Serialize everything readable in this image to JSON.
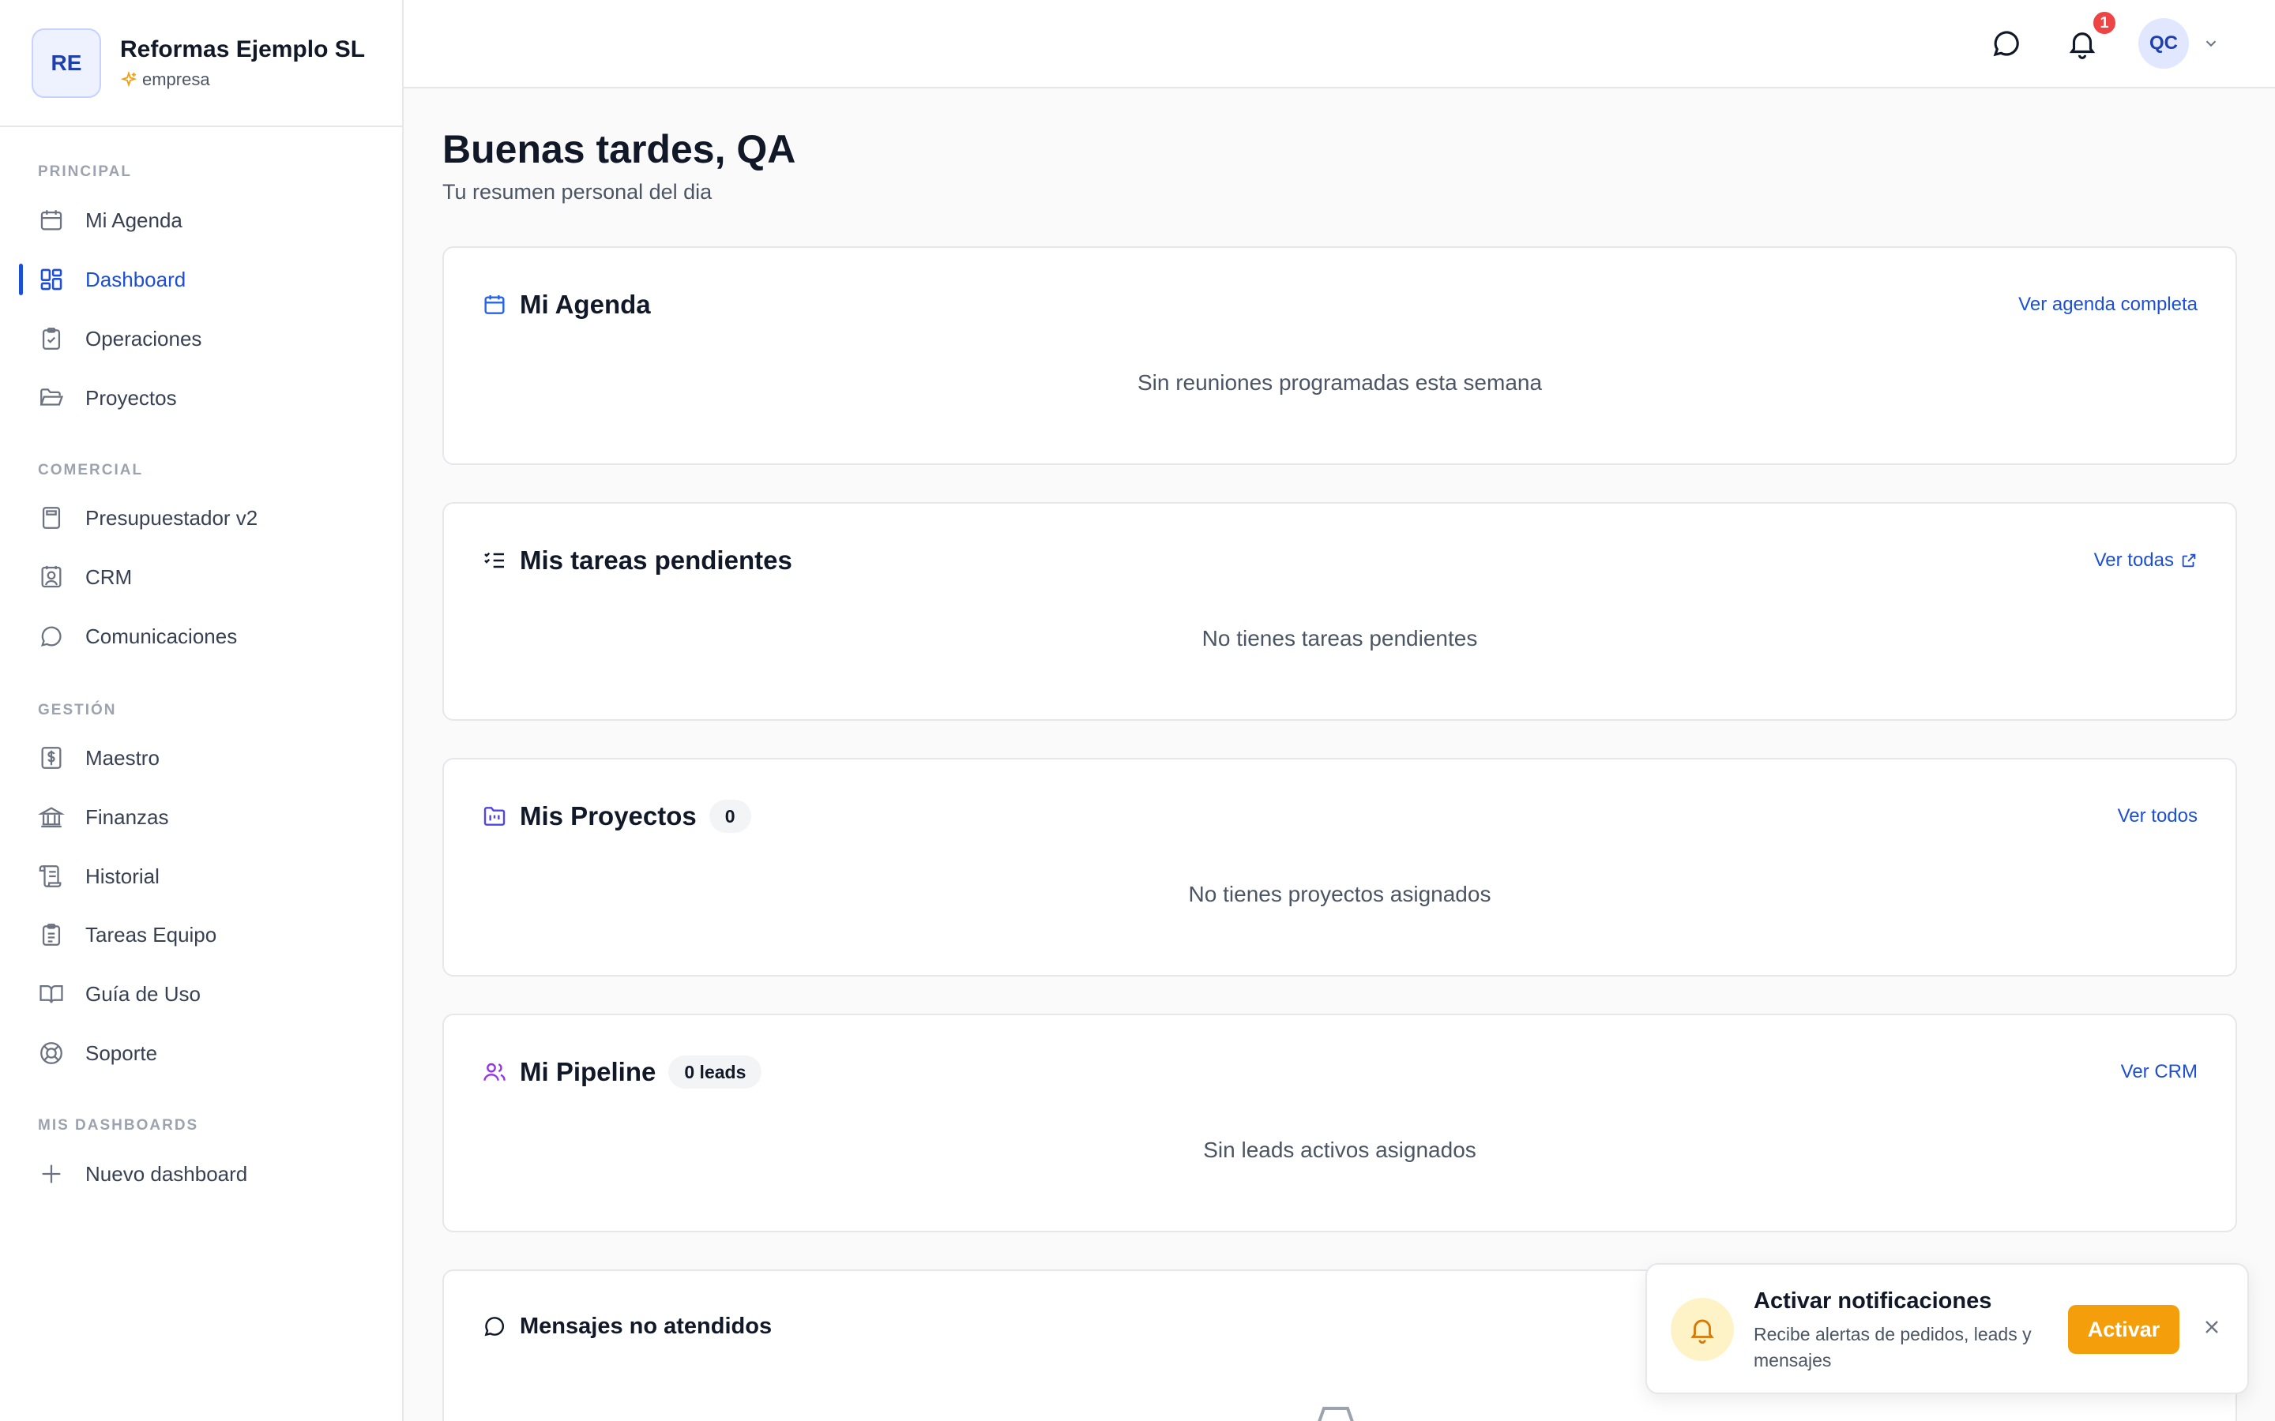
{
  "organization": {
    "initials": "RE",
    "name": "Reformas Ejemplo SL",
    "type": "empresa"
  },
  "sidebar": {
    "sections": [
      {
        "title": "PRINCIPAL",
        "items": [
          {
            "label": "Mi Agenda",
            "icon": "calendar-icon"
          },
          {
            "label": "Dashboard",
            "icon": "dashboard-grid-icon",
            "active": true
          },
          {
            "label": "Operaciones",
            "icon": "clipboard-check-icon"
          },
          {
            "label": "Proyectos",
            "icon": "folder-open-icon"
          }
        ]
      },
      {
        "title": "COMERCIAL",
        "items": [
          {
            "label": "Presupuestador v2",
            "icon": "calculator-icon"
          },
          {
            "label": "CRM",
            "icon": "contact-icon"
          },
          {
            "label": "Comunicaciones",
            "icon": "message-circle-icon"
          }
        ]
      },
      {
        "title": "GESTIÓN",
        "items": [
          {
            "label": "Maestro",
            "icon": "dollar-square-icon"
          },
          {
            "label": "Finanzas",
            "icon": "bank-icon"
          },
          {
            "label": "Historial",
            "icon": "scroll-icon"
          },
          {
            "label": "Tareas Equipo",
            "icon": "clipboard-list-icon"
          },
          {
            "label": "Guía de Uso",
            "icon": "book-open-icon"
          },
          {
            "label": "Soporte",
            "icon": "life-buoy-icon"
          }
        ]
      },
      {
        "title": "MIS DASHBOARDS",
        "items": [
          {
            "label": "Nuevo dashboard",
            "icon": "plus-icon"
          }
        ]
      }
    ]
  },
  "topbar": {
    "notification_count": "1",
    "user_initials": "QC"
  },
  "main": {
    "greeting": "Buenas tardes, QA",
    "subtitle": "Tu resumen personal del dia",
    "cards": [
      {
        "title": "Mi Agenda",
        "link": "Ver agenda completa",
        "empty": "Sin reuniones programadas esta semana"
      },
      {
        "title": "Mis tareas pendientes",
        "link": "Ver todas",
        "empty": "No tienes tareas pendientes"
      },
      {
        "title": "Mis Proyectos",
        "badge": "0",
        "link": "Ver todos",
        "empty": "No tienes proyectos asignados"
      },
      {
        "title": "Mi Pipeline",
        "badge": "0 leads",
        "link": "Ver CRM",
        "empty": "Sin leads activos asignados"
      },
      {
        "title": "Mensajes no atendidos"
      }
    ]
  },
  "toast": {
    "title": "Activar notificaciones",
    "text": "Recibe alertas de pedidos, leads y mensajes",
    "button": "Activar"
  },
  "colors": {
    "accent": "#1d4ed8",
    "warning": "#f59e0b",
    "badge": "#ef4444"
  }
}
